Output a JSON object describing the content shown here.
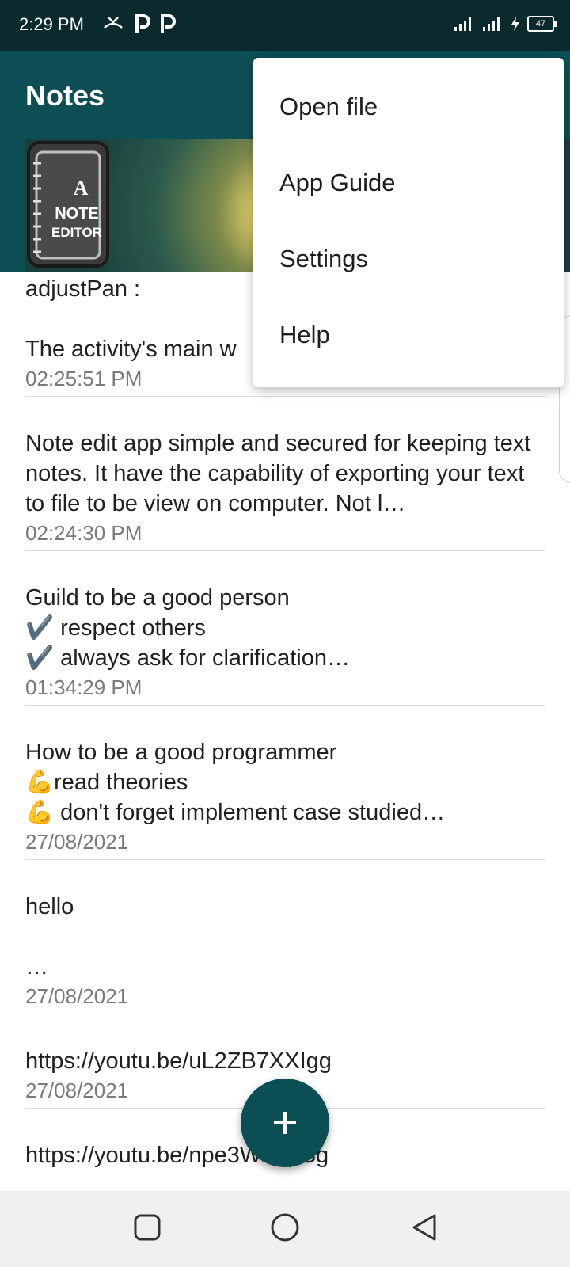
{
  "status_bar": {
    "time": "2:29 PM",
    "battery": "47"
  },
  "app": {
    "title": "Notes",
    "logo_text_a": "A",
    "logo_text_note": "NOTE",
    "logo_text_editor": "EDITOR"
  },
  "menu": {
    "items": [
      "Open file",
      "App Guide",
      "Settings",
      "Help"
    ]
  },
  "notes": [
    {
      "body": "adjustPan :\n\nThe activity's main w",
      "time": "02:25:51 PM"
    },
    {
      "body": "Note edit app simple and secured for keeping text notes. It have the capability of exporting your text to file to be view on computer. Not l…",
      "time": "02:24:30 PM"
    },
    {
      "body": "Guild to be a good person\n✔️ respect others\n✔️ always ask for clarification…",
      "time": "01:34:29 PM"
    },
    {
      "body": "How to be a good programmer\n💪read theories\n💪 don't forget implement case studied…",
      "time": "27/08/2021"
    },
    {
      "body": "hello\n\n…",
      "time": "27/08/2021"
    },
    {
      "body": "https://youtu.be/uL2ZB7XXIgg",
      "time": "27/08/2021"
    },
    {
      "body": "https://youtu.be/npe3Wr4tpSg",
      "time": ""
    }
  ],
  "fab": {
    "icon": "plus-icon"
  },
  "colors": {
    "primary": "#0d4f55",
    "status_bar": "#0a2a2e",
    "fab": "#0b4f54"
  }
}
